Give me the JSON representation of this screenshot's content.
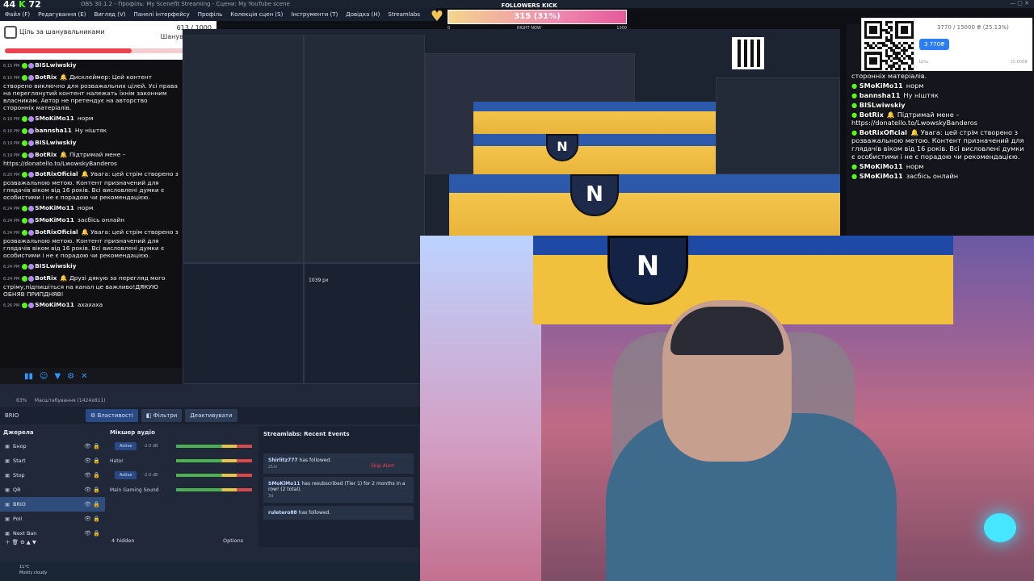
{
  "window": {
    "title": "OBS 30.1.2 - Профіль: My Scenefit Streaming - Сцени: My YouTube scene",
    "fps_label": "44",
    "kick_label": "72"
  },
  "menu": [
    "Файл (F)",
    "Редагування (E)",
    "Вигляд (V)",
    "Панелі інтерфейсу",
    "Профіль",
    "Колекція сцен (S)",
    "Інструменти (T)",
    "Довідка (H)",
    "Streamlabs"
  ],
  "kick": {
    "title": "FOLLOWERS KICK",
    "progress_text": "315 (31%)",
    "progress": 0.31,
    "scale_min": "0",
    "scale_max": "1000",
    "now_label": "RIGHT NOW"
  },
  "goal": {
    "title": "Ціль за шанувальниками",
    "count": "613 / 1000",
    "subtitle": "Шанувальники",
    "progress": 0.613
  },
  "chat": [
    {
      "time": "6:15 PM",
      "user": "BISLwiwskiy",
      "color": "#ffffff",
      "text": ""
    },
    {
      "time": "6:15 PM",
      "user": "BotRix",
      "color": "#ffffff",
      "text": "🔔 Дисклеймер: Цей контент створено виключно для розважальних цілей. Усі права на переглянутий контент належать їхнім законним власникам. Автор не претендує на авторство сторонніх матеріалів."
    },
    {
      "time": "6:16 PM",
      "user": "SMoKiMo11",
      "color": "#ffffff",
      "text": "норм"
    },
    {
      "time": "6:16 PM",
      "user": "bannsha11",
      "color": "#ffffff",
      "text": "Ну ніштяк"
    },
    {
      "time": "6:19 PM",
      "user": "BISLwiwskiy",
      "color": "#ffffff",
      "text": ""
    },
    {
      "time": "6:19 PM",
      "user": "BotRix",
      "color": "#ffffff",
      "text": "🔔 Підтримай мене – https://donatello.to/LwowskyBanderos"
    },
    {
      "time": "6:20 PM",
      "user": "BotRixOficial",
      "color": "#ffffff",
      "text": "🔔 Увага: цей стрім створено з розважальною метою. Контент призначений для глядачів віком від 16 років. Всі висловлені думки є особистими і не є порадою чи рекомендацією."
    },
    {
      "time": "6:24 PM",
      "user": "SMoKiMo11",
      "color": "#ffffff",
      "text": "норм"
    },
    {
      "time": "6:24 PM",
      "user": "SMoKiMo11",
      "color": "#ffffff",
      "text": "засбісь онлайн"
    },
    {
      "time": "6:24 PM",
      "user": "BotRixOficial",
      "color": "#ffffff",
      "text": "🔔 Увага: цей стрім створено з розважальною метою. Контент призначений для глядачів віком від 16 років. Всі висловлені думки є особистими і не є порадою чи рекомендацією."
    },
    {
      "time": "6:24 PM",
      "user": "BISLwiwskiy",
      "color": "#ffffff",
      "text": ""
    },
    {
      "time": "6:24 PM",
      "user": "BotRix",
      "color": "#ffffff",
      "text": "🔔 Друзі дякую за перегляд мого стріму,підпишіться на канал це важливо!ДЯКУЮ ОБНЯВ ПРИПДНЯВ!"
    },
    {
      "time": "6:26 PM",
      "user": "SMoKiMo11",
      "color": "#ffffff",
      "text": "ахахаха"
    }
  ],
  "obs": {
    "zoom_label": "63%",
    "scale_mode": "Масштабування (1424x811)",
    "source_name": "BRIO",
    "btn_props": "⚙ Властивості",
    "btn_filters": "◧ Фільтри",
    "btn_deactivate": "Деактивувати",
    "sources_title": "Джерела",
    "sources": [
      {
        "name": "Бнор",
        "sel": false
      },
      {
        "name": "Start",
        "sel": false
      },
      {
        "name": "Stop",
        "sel": false
      },
      {
        "name": "QR",
        "sel": false
      },
      {
        "name": "BRIO",
        "sel": true
      },
      {
        "name": "Poll",
        "sel": false
      },
      {
        "name": "Next Ban",
        "sel": false
      }
    ],
    "mixer_title": "Мікшер аудіо",
    "mixer": [
      {
        "name": "",
        "state": "Active",
        "db": "-2.0 dB"
      },
      {
        "name": "Hator",
        "state": "",
        "db": ""
      },
      {
        "name": "",
        "state": "Active",
        "db": "-2.0 dB"
      },
      {
        "name": "Main Gaming Sound",
        "state": "",
        "db": ""
      }
    ],
    "hidden_label": "4 hidden",
    "options_label": "Options",
    "events_title": "Streamlabs: Recent Events",
    "skip_alert": "Skip Alert",
    "events": [
      {
        "name": "Shirlitz777",
        "text": "has followed.",
        "ago": "21m"
      },
      {
        "name": "SMoKiMo11",
        "text": "has resubscribed (Tier 1) for 2 months in a row! (2 total).",
        "ago": "3d"
      },
      {
        "name": "ruletero88",
        "text": "has followed.",
        "ago": ""
      }
    ],
    "weather_temp": "11°C",
    "weather_text": "Mostly cloudy",
    "px_label": "1039 px"
  },
  "right_chat": [
    {
      "user": "",
      "text": "сторонніх матеріалів."
    },
    {
      "user": "SMoKiMo11",
      "text": "норм"
    },
    {
      "user": "bannsha11",
      "text": "Ну ніштяк"
    },
    {
      "user": "BISLwiwskiy",
      "text": ""
    },
    {
      "user": "BotRix",
      "text": "🔔 Підтримай мене – https://donatello.to/LwowskyBanderos"
    },
    {
      "user": "BotRixOficial",
      "text": "🔔 Увага: цей стрім створено з розважальною метою. Контент призначений для глядачів віком від 16 років. Всі висловлені думки є особистими і не є порадою чи рекомендацією."
    },
    {
      "user": "SMoKiMo11",
      "text": "норм"
    },
    {
      "user": "SMoKiMo11",
      "text": "засбісь онлайн"
    }
  ],
  "donate": {
    "amount": "3770 / 15000 ₴ (25.13%)",
    "button": "3 770₴",
    "progress_label": "Ціль",
    "max_label": "15 000₴"
  },
  "colors": {
    "kick_green": "#53fc18",
    "goal_red": "#e8434f",
    "obs_blue": "#2a4a86"
  }
}
